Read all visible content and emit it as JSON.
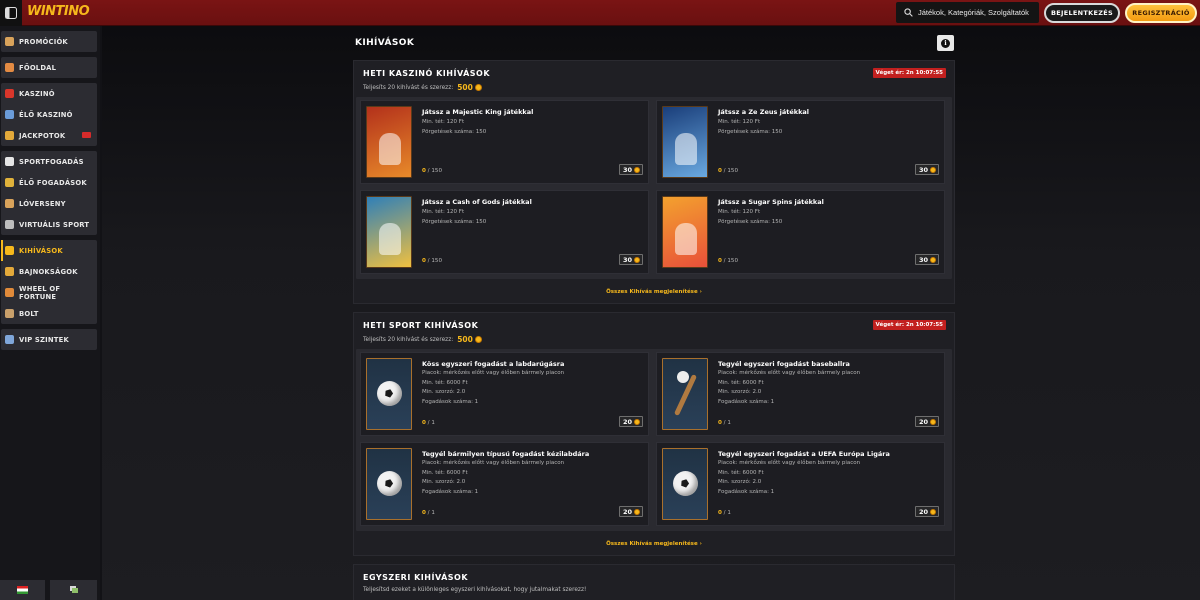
{
  "header": {
    "logo": "WINTINO",
    "search_placeholder": "Játékok, Kategóriák, Szolgáltatók",
    "login": "BEJELENTKEZÉS",
    "register": "REGISZTRÁCIÓ"
  },
  "sidebar": {
    "groups": [
      [
        {
          "label": "PROMÓCIÓK",
          "icon": "gift-icon",
          "color": "#d9a35b"
        }
      ],
      [
        {
          "label": "FŐOLDAL",
          "icon": "home-icon",
          "color": "#e38b43"
        }
      ],
      [
        {
          "label": "KASZINÓ",
          "icon": "cherries-icon",
          "color": "#d9362b"
        },
        {
          "label": "ÉLŐ KASZINÓ",
          "icon": "dealer-icon",
          "color": "#6a9bd8"
        },
        {
          "label": "JACKPOTOK",
          "icon": "horseshoe-icon",
          "color": "#e3a93a",
          "badge": true
        }
      ],
      [
        {
          "label": "SPORTFOGADÁS",
          "icon": "soccer-ball-icon",
          "color": "#e6e6e6"
        },
        {
          "label": "ÉLŐ FOGADÁSOK",
          "icon": "live-ball-icon",
          "color": "#e0b23b"
        },
        {
          "label": "LÓVERSENY",
          "icon": "horse-icon",
          "color": "#d9a35b"
        },
        {
          "label": "VIRTUÁLIS SPORT",
          "icon": "gamepad-icon",
          "color": "#bdbdbd"
        }
      ],
      [
        {
          "label": "KIHÍVÁSOK",
          "icon": "challenge-icon",
          "color": "#f6b81c",
          "active": true
        },
        {
          "label": "BAJNOKSÁGOK",
          "icon": "trophy-icon",
          "color": "#e3a93a"
        },
        {
          "label": "WHEEL OF FORTUNE",
          "icon": "wheel-icon",
          "color": "#e08a3a"
        },
        {
          "label": "BOLT",
          "icon": "shop-icon",
          "color": "#c9a06b"
        }
      ],
      [
        {
          "label": "VIP SZINTEK",
          "icon": "vip-icon",
          "color": "#7fa6d9"
        }
      ]
    ]
  },
  "page": {
    "title": "KIHÍVÁSOK"
  },
  "sections": [
    {
      "title": "HETI KASZINÓ KIHÍVÁSOK",
      "subtitle": "Teljesíts 20 kihívást és szerezz:",
      "points": "500",
      "timer": "Véget ér: 2n 10:07:55",
      "link": "Összes Kihívás megjelenítése ›",
      "cards": [
        {
          "title": "Játssz a Majestic King játékkal",
          "lines": [
            "Min. tét: 120 Ft",
            "Pörgetések száma: 150"
          ],
          "progress_done": "0",
          "progress_total": " / 150",
          "reward": "30",
          "thumb": "majestic-king-thumb",
          "colors": [
            "#b3311b",
            "#e88a2a"
          ]
        },
        {
          "title": "Játssz a Ze Zeus játékkal",
          "lines": [
            "Min. tét: 120 Ft",
            "Pörgetések száma: 150"
          ],
          "progress_done": "0",
          "progress_total": " / 150",
          "reward": "30",
          "thumb": "ze-zeus-thumb",
          "colors": [
            "#1a3e7a",
            "#6aa9e0"
          ]
        },
        {
          "title": "Játssz a Cash of Gods játékkal",
          "lines": [
            "Min. tét: 120 Ft",
            "Pörgetések száma: 150"
          ],
          "progress_done": "0",
          "progress_total": " / 150",
          "reward": "30",
          "thumb": "cash-of-gods-thumb",
          "colors": [
            "#2f7fb8",
            "#f0c040"
          ]
        },
        {
          "title": "Játssz a Sugar Spins játékkal",
          "lines": [
            "Min. tét: 120 Ft",
            "Pörgetések száma: 150"
          ],
          "progress_done": "0",
          "progress_total": " / 150",
          "reward": "30",
          "thumb": "sugar-spins-thumb",
          "colors": [
            "#f3a12e",
            "#e8503a"
          ]
        }
      ]
    },
    {
      "title": "HETI SPORT KIHÍVÁSOK",
      "subtitle": "Teljesíts 20 kihívást és szerezz:",
      "points": "500",
      "timer": "Véget ér: 2n 10:07:55",
      "link": "Összes Kihívás megjelenítése ›",
      "cards": [
        {
          "title": "Köss egyszeri fogadást a labdarúgásra",
          "lines": [
            "Piacok: mérkőzés előtt vagy élőben bármely piacon",
            "Min. tét: 6000 Ft",
            "Min. szorzó: 2.0",
            "Fogadások száma: 1"
          ],
          "progress_done": "0",
          "progress_total": " / 1",
          "reward": "20",
          "thumb": "soccer-ball-thumb"
        },
        {
          "title": "Tegyél egyszeri fogadást baseballra",
          "lines": [
            "Piacok: mérkőzés előtt vagy élőben bármely piacon",
            "Min. tét: 6000 Ft",
            "Min. szorzó: 2.0",
            "Fogadások száma: 1"
          ],
          "progress_done": "0",
          "progress_total": " / 1",
          "reward": "20",
          "thumb": "baseball-thumb"
        },
        {
          "title": "Tegyél bármilyen típusú fogadást kézilabdára",
          "lines": [
            "Piacok: mérkőzés előtt vagy élőben bármely piacon",
            "Min. tét: 6000 Ft",
            "Min. szorzó: 2.0",
            "Fogadások száma: 1"
          ],
          "progress_done": "0",
          "progress_total": " / 1",
          "reward": "20",
          "thumb": "handball-thumb"
        },
        {
          "title": "Tegyél egyszeri fogadást a UEFA Európa Ligára",
          "lines": [
            "Piacok: mérkőzés előtt vagy élőben bármely piacon",
            "Min. tét: 6000 Ft",
            "Min. szorzó: 2.0",
            "Fogadások száma: 1"
          ],
          "progress_done": "0",
          "progress_total": " / 1",
          "reward": "20",
          "thumb": "europa-league-thumb"
        }
      ]
    },
    {
      "title": "EGYSZERI KIHÍVÁSOK",
      "subtitle": "Teljesítsd ezeket a különleges egyszeri kihívásokat, hogy jutalmakat szerezz!"
    }
  ]
}
